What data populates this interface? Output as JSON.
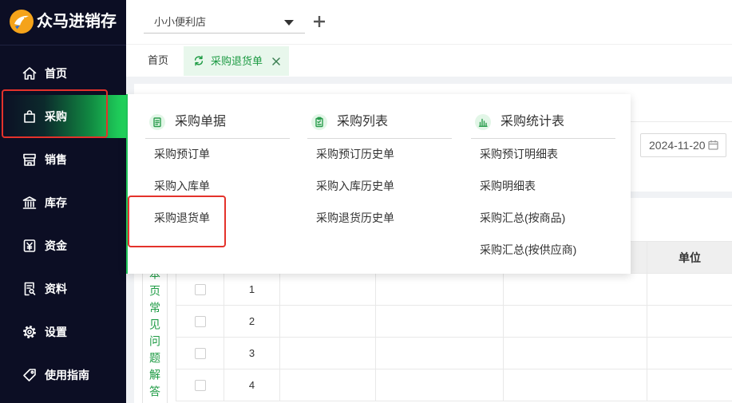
{
  "app": {
    "logo_text": "众马进销存",
    "logo_icon": "horse-logo-icon"
  },
  "sidebar": {
    "items": [
      {
        "label": "首页",
        "icon": "home-icon"
      },
      {
        "label": "采购",
        "icon": "shopping-bag-icon",
        "active": true
      },
      {
        "label": "销售",
        "icon": "store-icon"
      },
      {
        "label": "库存",
        "icon": "warehouse-icon"
      },
      {
        "label": "资金",
        "icon": "yen-icon"
      },
      {
        "label": "资料",
        "icon": "document-icon"
      },
      {
        "label": "设置",
        "icon": "gear-icon"
      },
      {
        "label": "使用指南",
        "icon": "tag-icon"
      }
    ]
  },
  "header": {
    "store_name": "小小便利店",
    "add_icon": "plus-icon"
  },
  "tabs": [
    {
      "label": "首页"
    },
    {
      "label": "采购退货单",
      "active": true
    }
  ],
  "purchase_menu": {
    "columns": [
      {
        "title": "采购单据",
        "icon": "clipboard-icon",
        "items": [
          "采购预订单",
          "采购入库单",
          "采购退货单"
        ]
      },
      {
        "title": "采购列表",
        "icon": "checklist-icon",
        "items": [
          "采购预订历史单",
          "采购入库历史单",
          "采购退货历史单"
        ]
      },
      {
        "title": "采购统计表",
        "icon": "bar-chart-icon",
        "items": [
          "采购预订明细表",
          "采购明细表",
          "采购汇总(按商品)",
          "采购汇总(按供应商)"
        ]
      }
    ]
  },
  "form": {
    "date": "2024-11-20"
  },
  "help_link": "本页常见问题解答",
  "table": {
    "headers": {
      "unit": "单位"
    },
    "rows": [
      {
        "index": "1"
      },
      {
        "index": "2"
      },
      {
        "index": "3"
      },
      {
        "index": "4"
      }
    ]
  },
  "colors": {
    "sidebar_bg": "#0c0e24",
    "accent_green": "#1fc45a",
    "active_tab_bg": "#e8f7ec",
    "active_text_green": "#1e9b44",
    "annotation_red": "#e4322b"
  }
}
